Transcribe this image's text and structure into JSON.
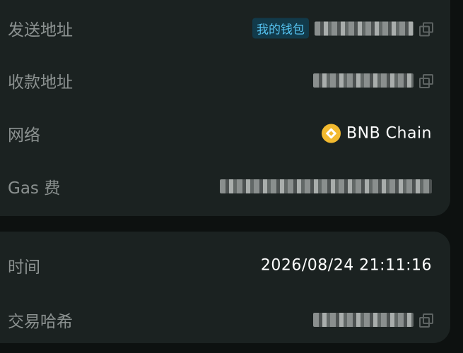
{
  "rows_top": [
    {
      "label": "发送地址",
      "tag": "我的钱包",
      "masked": true
    },
    {
      "label": "收款地址",
      "masked": true
    },
    {
      "label": "网络",
      "value": "BNB Chain",
      "icon": "bnb-chain-icon"
    },
    {
      "label": "Gas 费",
      "masked": true
    }
  ],
  "rows_bottom": [
    {
      "label": "时间",
      "value": "2026/08/24 21:11:16"
    },
    {
      "label": "交易哈希",
      "masked": true
    }
  ]
}
